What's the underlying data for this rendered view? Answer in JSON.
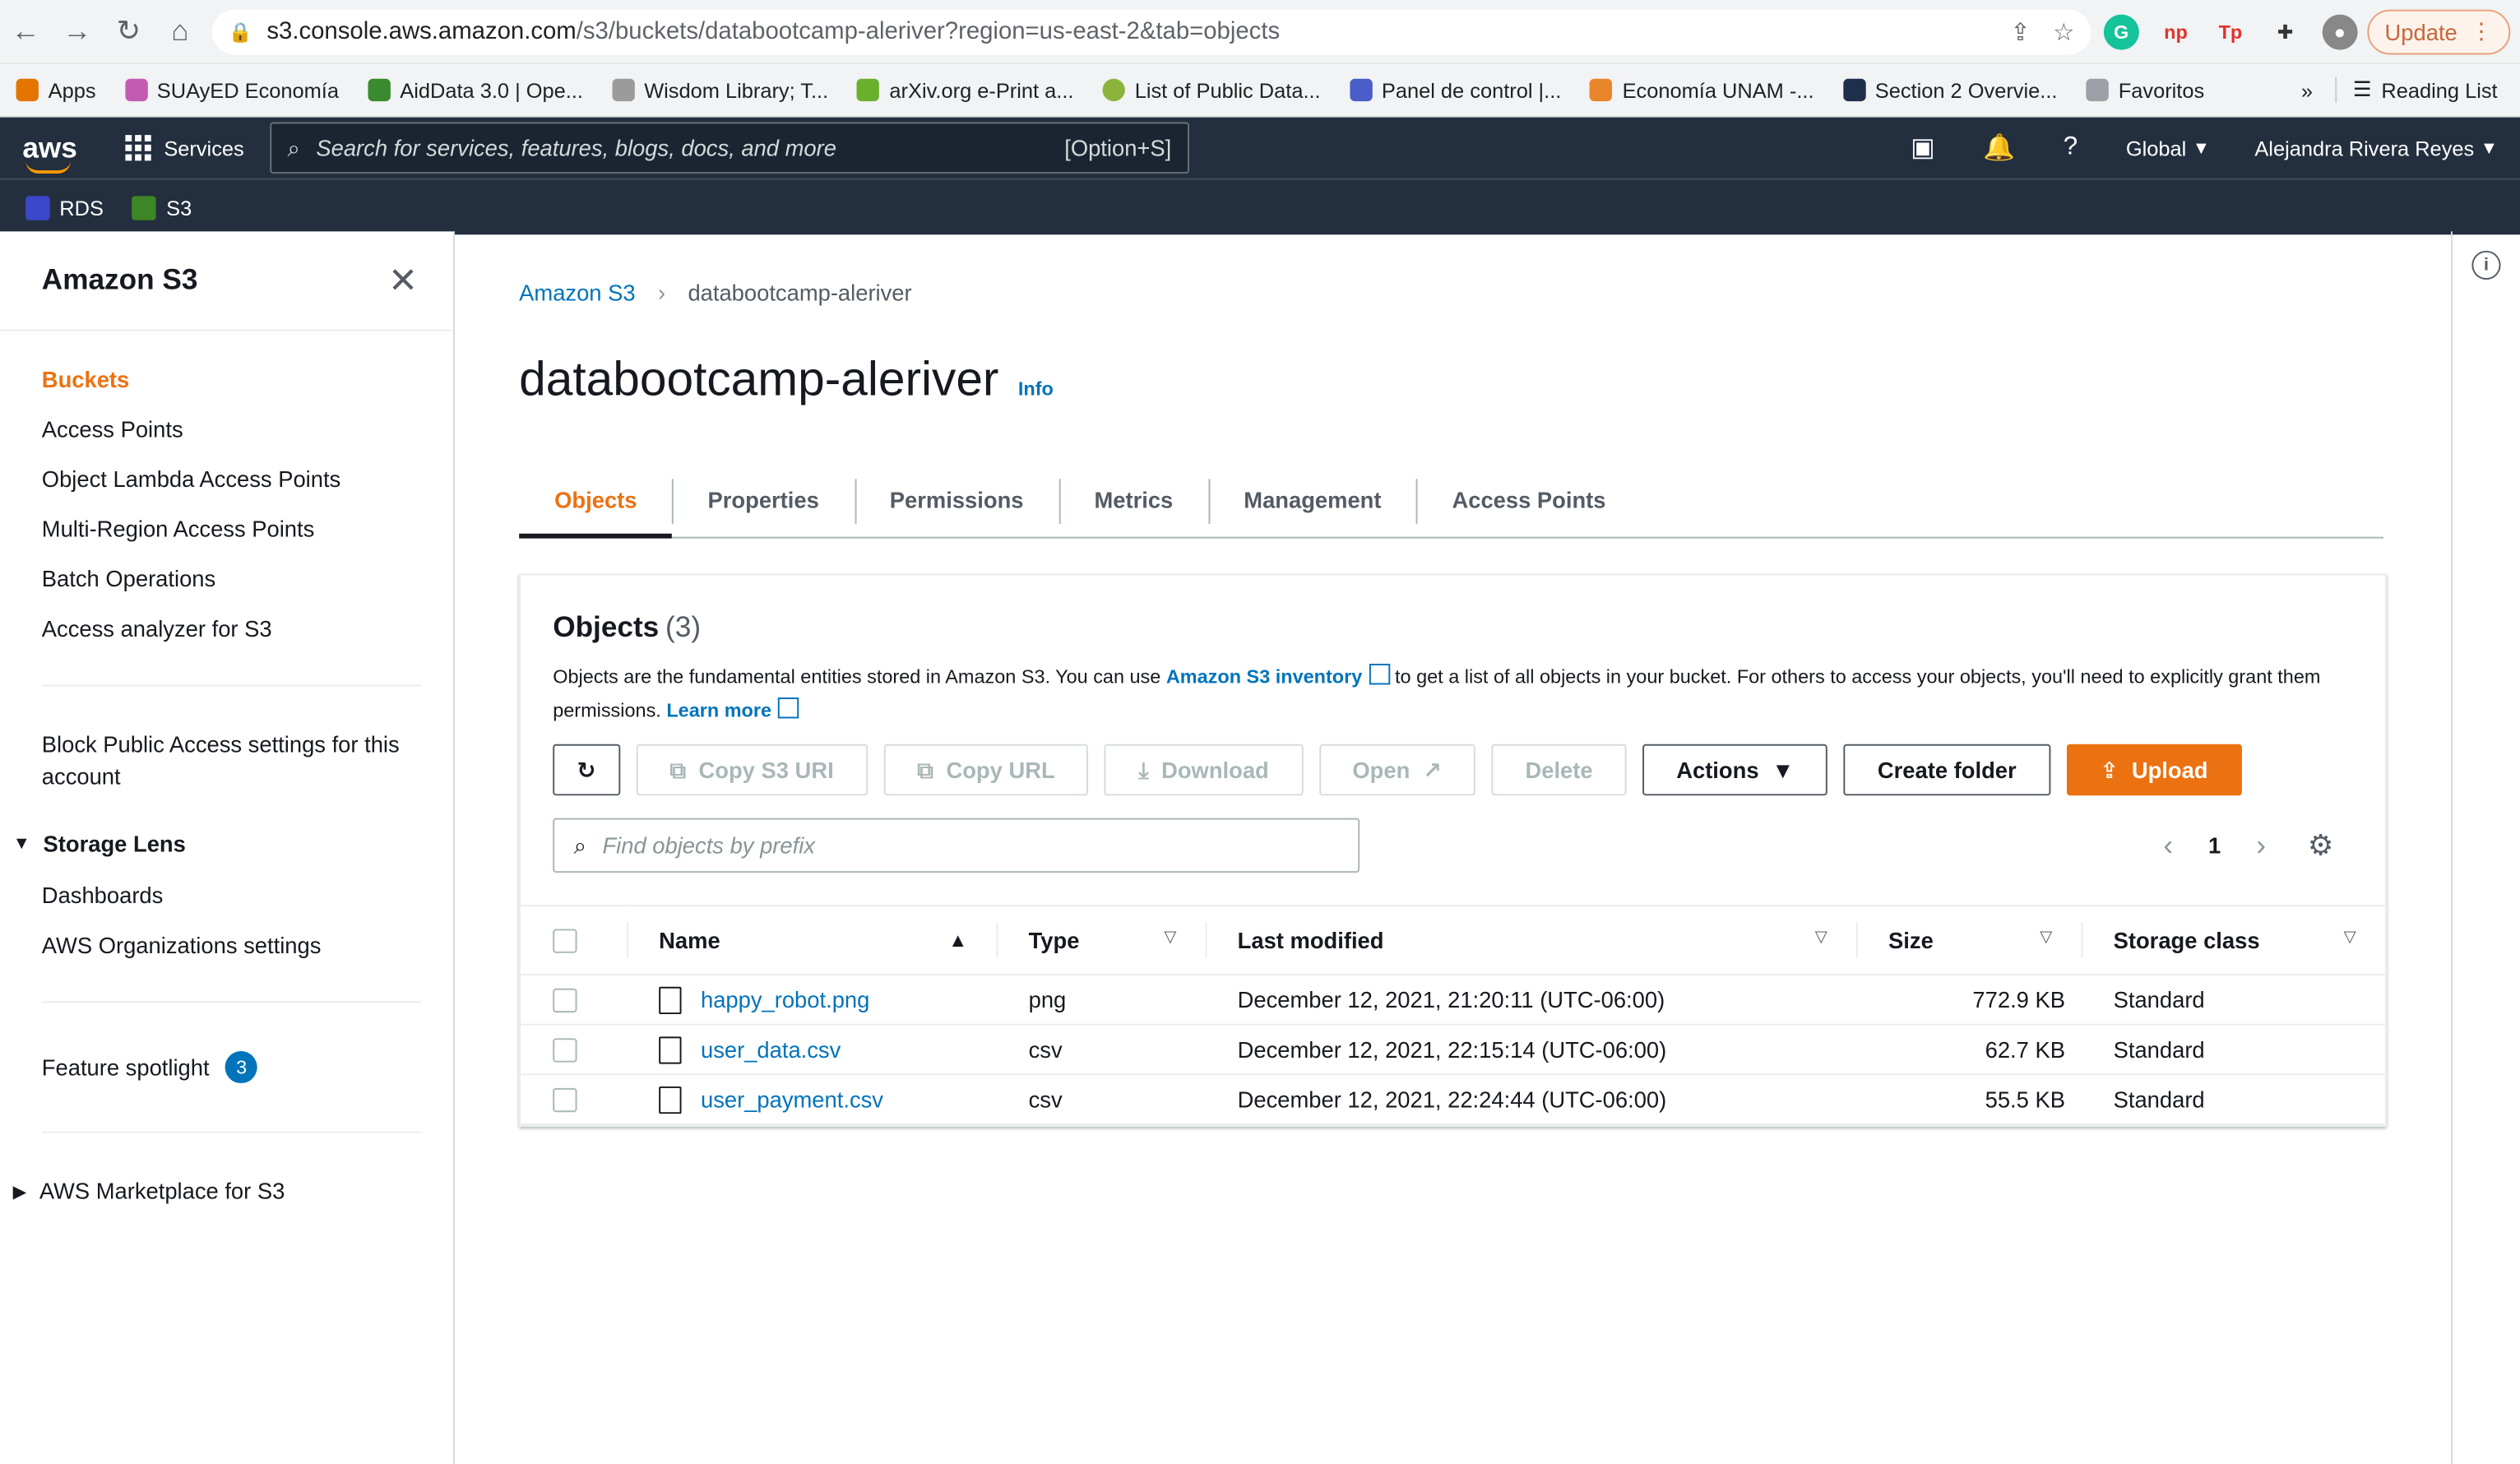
{
  "browser": {
    "url_domain": "s3.console.aws.amazon.com",
    "url_path": "/s3/buckets/databootcamp-aleriver?region=us-east-2&tab=objects",
    "update_label": "Update",
    "bookmarks": [
      "Apps",
      "SUAyED Economía",
      "AidData 3.0 | Ope...",
      "Wisdom Library; T...",
      "arXiv.org e-Print a...",
      "List of Public Data...",
      "Panel de control |...",
      "Economía UNAM -...",
      "Section 2 Overvie...",
      "Favoritos"
    ],
    "more": "»",
    "reading_list": "Reading List"
  },
  "aws": {
    "logo": "aws",
    "services": "Services",
    "search_placeholder": "Search for services, features, blogs, docs, and more",
    "search_hint": "[Option+S]",
    "region": "Global",
    "user": "Alejandra Rivera Reyes",
    "favorites": [
      "RDS",
      "S3"
    ]
  },
  "sidebar": {
    "title": "Amazon S3",
    "items": [
      "Buckets",
      "Access Points",
      "Object Lambda Access Points",
      "Multi-Region Access Points",
      "Batch Operations",
      "Access analyzer for S3"
    ],
    "block_public": "Block Public Access settings for this account",
    "storage_lens": "Storage Lens",
    "storage_lens_items": [
      "Dashboards",
      "AWS Organizations settings"
    ],
    "feature_spotlight": "Feature spotlight",
    "feature_count": "3",
    "marketplace": "AWS Marketplace for S3"
  },
  "breadcrumb": {
    "root": "Amazon S3",
    "current": "databootcamp-aleriver"
  },
  "page": {
    "title": "databootcamp-aleriver",
    "info": "Info"
  },
  "tabs": [
    "Objects",
    "Properties",
    "Permissions",
    "Metrics",
    "Management",
    "Access Points"
  ],
  "objects": {
    "title": "Objects",
    "count": "(3)",
    "desc_1": "Objects are the fundamental entities stored in Amazon S3. You can use ",
    "inventory_link": "Amazon S3 inventory",
    "desc_2": " to get a list of all objects in your bucket. For others to access your objects, you'll need to explicitly grant them permissions. ",
    "learn_more": "Learn more",
    "buttons": {
      "copy_uri": "Copy S3 URI",
      "copy_url": "Copy URL",
      "download": "Download",
      "open": "Open",
      "delete": "Delete",
      "actions": "Actions",
      "create_folder": "Create folder",
      "upload": "Upload"
    },
    "filter_placeholder": "Find objects by prefix",
    "page": "1",
    "columns": [
      "Name",
      "Type",
      "Last modified",
      "Size",
      "Storage class"
    ],
    "rows": [
      {
        "name": "happy_robot.png",
        "type": "png",
        "modified": "December 12, 2021, 21:20:11 (UTC-06:00)",
        "size": "772.9 KB",
        "class": "Standard"
      },
      {
        "name": "user_data.csv",
        "type": "csv",
        "modified": "December 12, 2021, 22:15:14 (UTC-06:00)",
        "size": "62.7 KB",
        "class": "Standard"
      },
      {
        "name": "user_payment.csv",
        "type": "csv",
        "modified": "December 12, 2021, 22:24:44 (UTC-06:00)",
        "size": "55.5 KB",
        "class": "Standard"
      }
    ]
  },
  "colors": {
    "accent": "#ec7211",
    "link": "#0073bb",
    "header": "#232f3e"
  }
}
